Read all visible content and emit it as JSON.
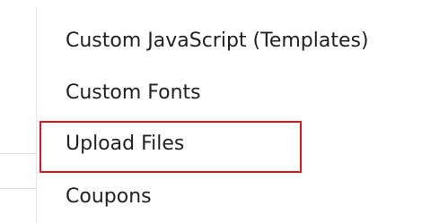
{
  "menu": {
    "items": [
      {
        "label": "Custom JavaScript (Templates)"
      },
      {
        "label": "Custom Fonts"
      },
      {
        "label": "Upload Files"
      },
      {
        "label": "Coupons"
      }
    ]
  },
  "highlight": {
    "target": "Upload Files",
    "color": "#e0151f"
  },
  "colors": {
    "text": "#202124",
    "background": "#ffffff",
    "divider": "#e3e3e3"
  }
}
